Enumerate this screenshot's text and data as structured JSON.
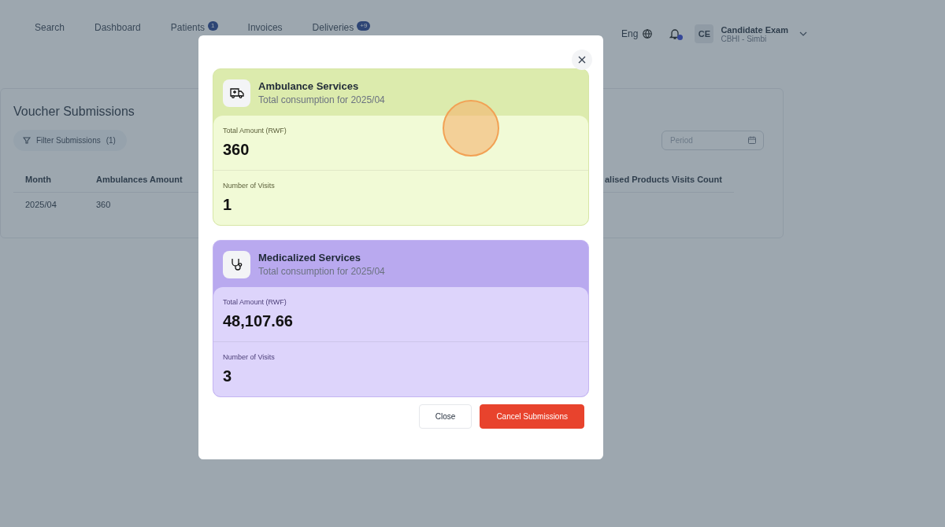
{
  "nav": {
    "items": [
      {
        "label": "Search"
      },
      {
        "label": "Dashboard"
      },
      {
        "label": "Patients",
        "badge": "1"
      },
      {
        "label": "Invoices"
      },
      {
        "label": "Deliveries",
        "badge": "+9"
      }
    ]
  },
  "language": "Eng",
  "notifications": {
    "unread": true
  },
  "user": {
    "initials": "CE",
    "name": "Candidate Exam",
    "org": "CBHI - Simbi"
  },
  "page": {
    "title": "Voucher Submissions",
    "filter": {
      "label": "Filter Submissions",
      "count": "(1)"
    },
    "period": {
      "placeholder": "Period"
    },
    "table": {
      "columns": [
        "Month",
        "Ambulances Amount",
        "alised Products Visits Count"
      ],
      "rows": [
        {
          "cells": [
            "2025/04",
            "360"
          ]
        }
      ]
    }
  },
  "modal": {
    "services": [
      {
        "kind": "ambulance",
        "title": "Ambulance Services",
        "subtitle": "Total consumption for 2025/04",
        "stats": [
          {
            "label": "Total Amount (RWF)",
            "value": "360"
          },
          {
            "label": "Number of Visits",
            "value": "1"
          }
        ]
      },
      {
        "kind": "medicalized",
        "title": "Medicalized Services",
        "subtitle": "Total consumption for 2025/04",
        "stats": [
          {
            "label": "Total Amount (RWF)",
            "value": "48,107.66"
          },
          {
            "label": "Number of Visits",
            "value": "3"
          }
        ]
      }
    ],
    "buttons": [
      {
        "label": "Close",
        "kind": "secondary"
      },
      {
        "label": "Cancel Submissions",
        "kind": "danger"
      }
    ]
  }
}
